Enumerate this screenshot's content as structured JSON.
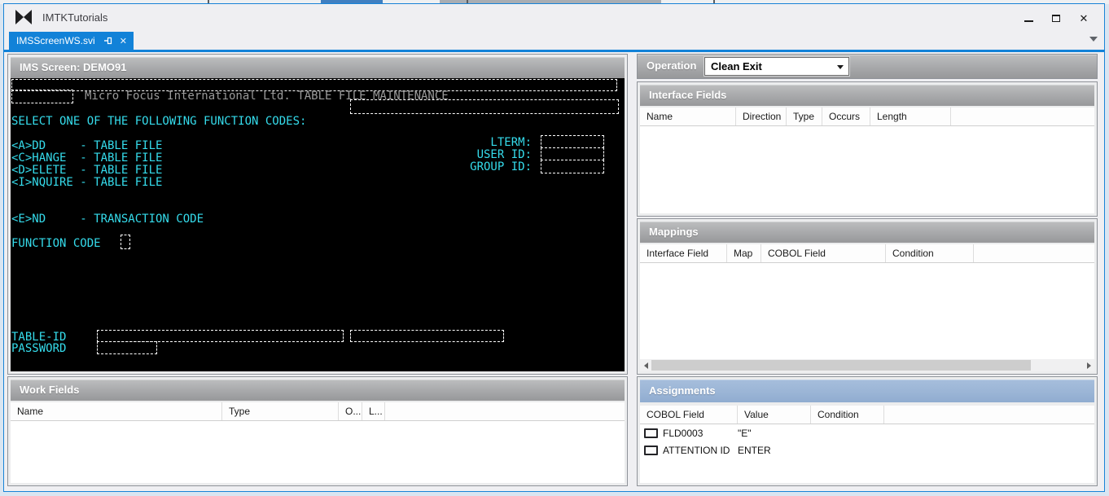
{
  "window": {
    "title": "IMTKTutorials",
    "tab_label": "IMSScreenWS.svi"
  },
  "colors": {
    "accent_blue": "#1282d8",
    "terminal_cyan": "#35dcec",
    "terminal_gray": "#9a9a9a",
    "terminal_bg": "#000000",
    "section_header_gray": "#a9aaac",
    "active_section_header_blue": "#9bb5d6"
  },
  "ims_screen": {
    "title": "IMS Screen: DEMO91",
    "banner": "Micro Focus International Ltd. TABLE FILE MAINTENANCE",
    "select_line": "SELECT ONE OF THE FOLLOWING FUNCTION CODES:",
    "options": [
      "<A>DD     - TABLE FILE",
      "<C>HANGE  - TABLE FILE",
      "<D>ELETE  - TABLE FILE",
      "<I>NQUIRE - TABLE FILE"
    ],
    "end_line": "<E>ND     - TRANSACTION CODE",
    "labels": {
      "lterm": "LTERM:",
      "user_id": "USER ID:",
      "group_id": "GROUP ID:",
      "function_code": "FUNCTION CODE",
      "table_id": "TABLE-ID",
      "password": "PASSWORD"
    }
  },
  "operation": {
    "label": "Operation",
    "value": "Clean Exit"
  },
  "interface_fields": {
    "title": "Interface Fields",
    "columns": [
      "Name",
      "Direction",
      "Type",
      "Occurs",
      "Length"
    ],
    "rows": []
  },
  "mappings": {
    "title": "Mappings",
    "columns": [
      "Interface Field",
      "Map",
      "COBOL Field",
      "Condition"
    ],
    "rows": []
  },
  "assignments": {
    "title": "Assignments",
    "columns": [
      "COBOL Field",
      "Value",
      "Condition"
    ],
    "rows": [
      {
        "cobol_field": "FLD0003",
        "value": "\"E\"",
        "condition": ""
      },
      {
        "cobol_field": "ATTENTION ID",
        "value": "ENTER",
        "condition": ""
      }
    ]
  },
  "work_fields": {
    "title": "Work Fields",
    "columns": [
      "Name",
      "Type",
      "O...",
      "L..."
    ],
    "rows": []
  }
}
